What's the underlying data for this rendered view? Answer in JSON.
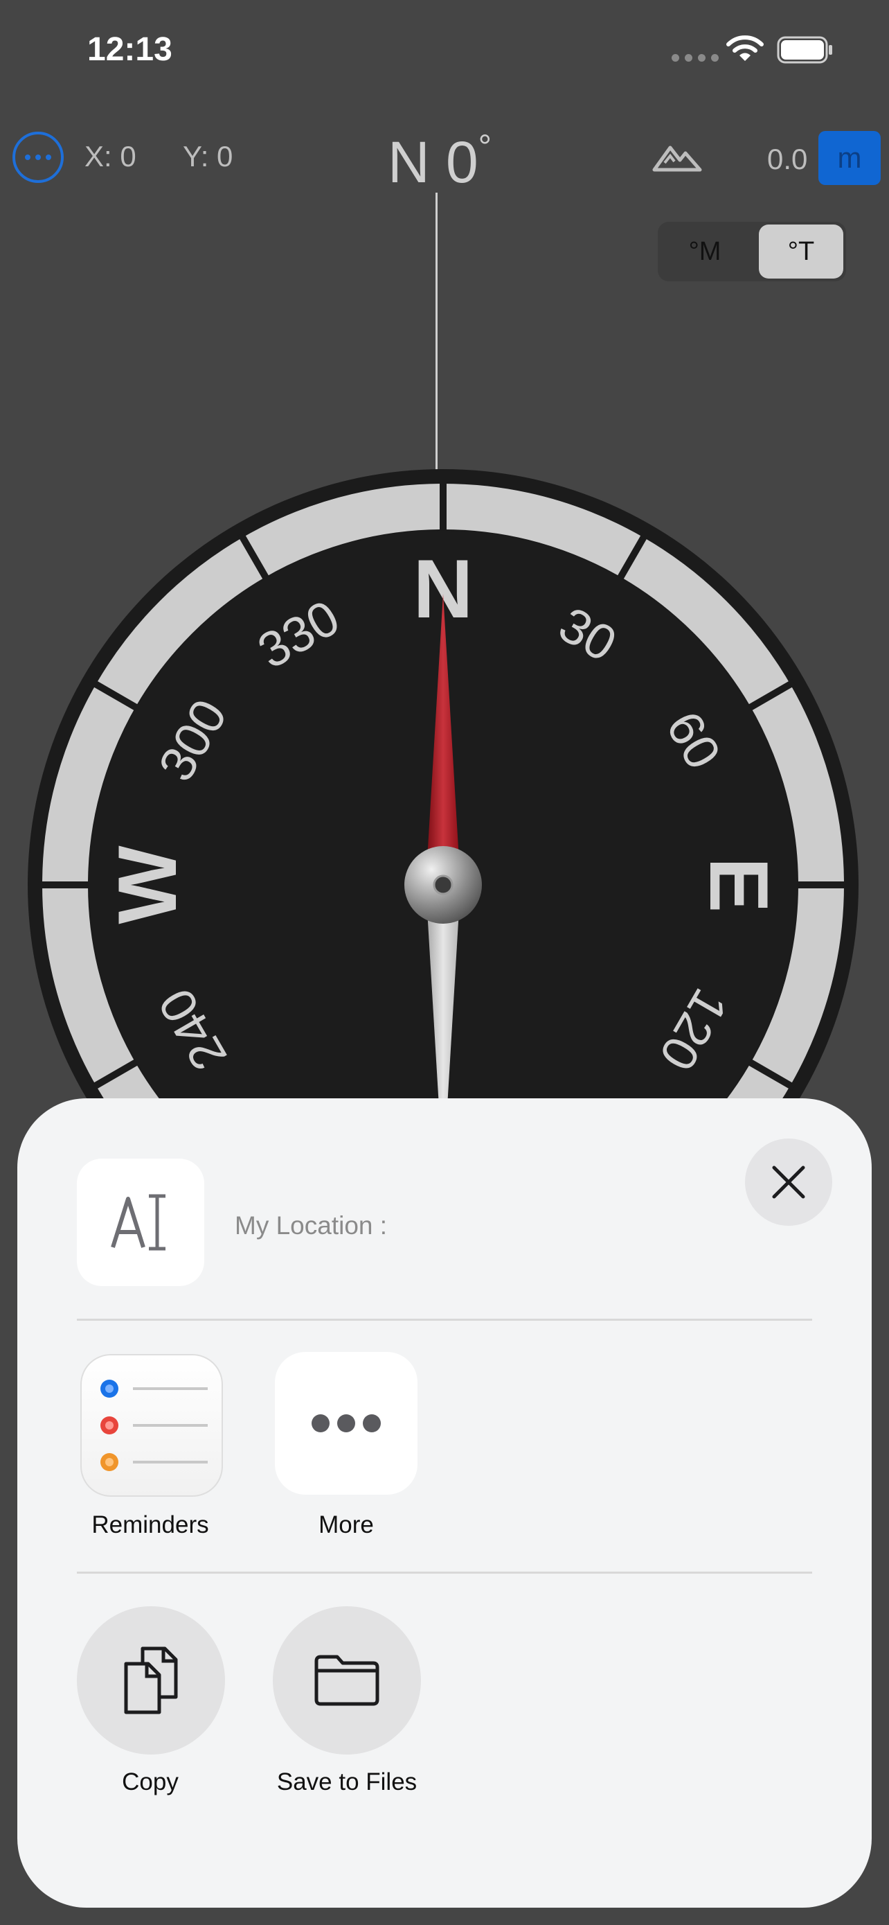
{
  "status_bar": {
    "time": "12:13"
  },
  "top_bar": {
    "x_label": "X: 0",
    "y_label": "Y: 0",
    "heading_dir": "N",
    "heading_value": "0",
    "heading_symbol": "°",
    "elevation": "0.0",
    "unit": "m"
  },
  "mode_toggle": {
    "magnetic": "°M",
    "true": "°T",
    "selected": "true"
  },
  "compass": {
    "cardinals": [
      "N",
      "E",
      "W"
    ],
    "degree_labels": [
      "30",
      "60",
      "120",
      "240",
      "300",
      "330"
    ],
    "heading_degrees": 0
  },
  "share_sheet": {
    "title": "My Location :",
    "apps": [
      {
        "label": "Reminders",
        "icon": "reminders-icon"
      },
      {
        "label": "More",
        "icon": "more-icon"
      }
    ],
    "actions": [
      {
        "label": "Copy",
        "icon": "copy-icon"
      },
      {
        "label": "Save to Files",
        "icon": "folder-icon"
      }
    ]
  },
  "colors": {
    "background": "#454545",
    "accent_blue": "#1066d2",
    "needle_red": "#a3141f",
    "sheet_bg": "#f3f4f5"
  }
}
